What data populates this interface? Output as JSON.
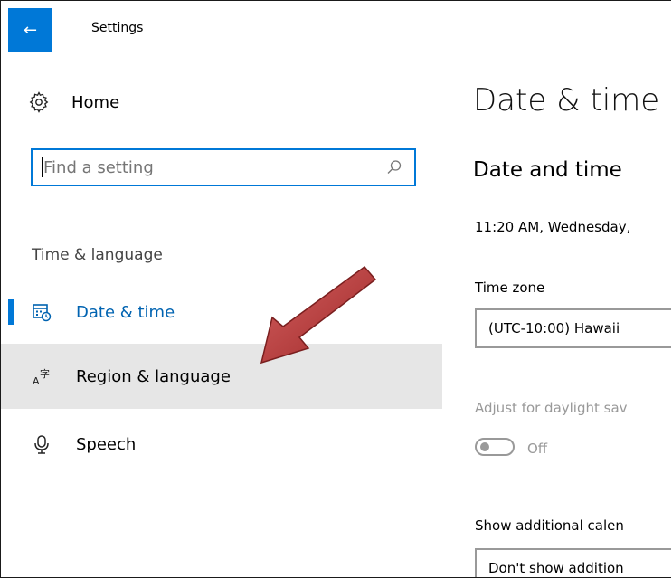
{
  "window": {
    "title": "Settings",
    "back_icon": "back-arrow-icon",
    "accent": "#0078d7"
  },
  "sidebar": {
    "home_label": "Home",
    "search_placeholder": "Find a setting",
    "section_heading": "Time & language",
    "items": [
      {
        "label": "Date & time",
        "icon": "calendar-clock-icon",
        "selected": true
      },
      {
        "label": "Region & language",
        "icon": "language-icon",
        "hovered": true
      },
      {
        "label": "Speech",
        "icon": "microphone-icon"
      }
    ]
  },
  "main": {
    "page_title": "Date & time",
    "section_title": "Date and time",
    "current_datetime": "11:20 AM, Wednesday,",
    "time_zone_label": "Time zone",
    "time_zone_value": "(UTC-10:00) Hawaii",
    "dst_label": "Adjust for daylight sav",
    "dst_toggle_state": "Off",
    "calendar_label": "Show additional calen",
    "calendar_value": "Don't show addition"
  },
  "annotation": {
    "arrow_color": "#b23a3a"
  }
}
